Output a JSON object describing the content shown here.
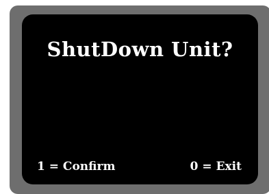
{
  "dialog": {
    "title": "ShutDown Unit?",
    "confirm_label": "1 = Confirm",
    "exit_label": "0 = Exit"
  },
  "colors": {
    "bezel": "#6e6e6e",
    "screen": "#000000",
    "text": "#ffffff"
  }
}
